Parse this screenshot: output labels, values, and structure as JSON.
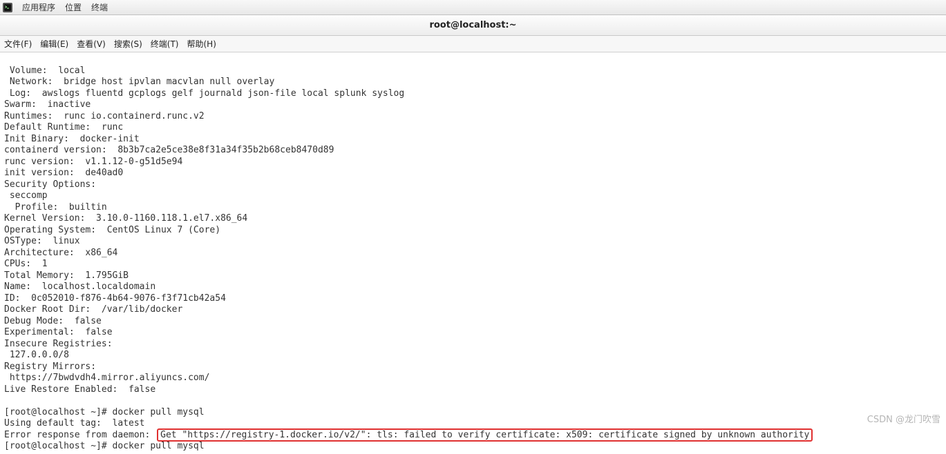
{
  "top_panel": {
    "apps": "应用程序",
    "places": "位置",
    "terminal": "终端"
  },
  "window": {
    "title": "root@localhost:~"
  },
  "menubar": {
    "file": "文件(F)",
    "edit": "编辑(E)",
    "view": "查看(V)",
    "search": "搜索(S)",
    "terminal": "终端(T)",
    "help": "帮助(H)"
  },
  "output": {
    "l01": " Volume:  local",
    "l02": " Network:  bridge host ipvlan macvlan null overlay",
    "l03": " Log:  awslogs fluentd gcplogs gelf journald json-file local splunk syslog",
    "l04": "Swarm:  inactive",
    "l05": "Runtimes:  runc io.containerd.runc.v2",
    "l06": "Default Runtime:  runc",
    "l07": "Init Binary:  docker-init",
    "l08": "containerd version:  8b3b7ca2e5ce38e8f31a34f35b2b68ceb8470d89",
    "l09": "runc version:  v1.1.12-0-g51d5e94",
    "l10": "init version:  de40ad0",
    "l11": "Security Options:",
    "l12": " seccomp",
    "l13": "  Profile:  builtin",
    "l14": "Kernel Version:  3.10.0-1160.118.1.el7.x86_64",
    "l15": "Operating System:  CentOS Linux 7 (Core)",
    "l16": "OSType:  linux",
    "l17": "Architecture:  x86_64",
    "l18": "CPUs:  1",
    "l19": "Total Memory:  1.795GiB",
    "l20": "Name:  localhost.localdomain",
    "l21": "ID:  0c052010-f876-4b64-9076-f3f71cb42a54",
    "l22": "Docker Root Dir:  /var/lib/docker",
    "l23": "Debug Mode:  false",
    "l24": "Experimental:  false",
    "l25": "Insecure Registries:",
    "l26": " 127.0.0.0/8",
    "l27": "Registry Mirrors:",
    "l28": " https://7bwdvdh4.mirror.aliyuncs.com/",
    "l29": "Live Restore Enabled:  false",
    "l30": "",
    "l31": "[root@localhost ~]# docker pull mysql",
    "l32": "Using default tag:  latest",
    "err_prefix": "Error response from daemon: ",
    "err_msg": "Get \"https://registry-1.docker.io/v2/\": tls: failed to verify certificate: x509: certificate signed by unknown authority",
    "l34": "[root@localhost ~]# docker pull mysql"
  },
  "watermark": "CSDN @龙门吹雪"
}
